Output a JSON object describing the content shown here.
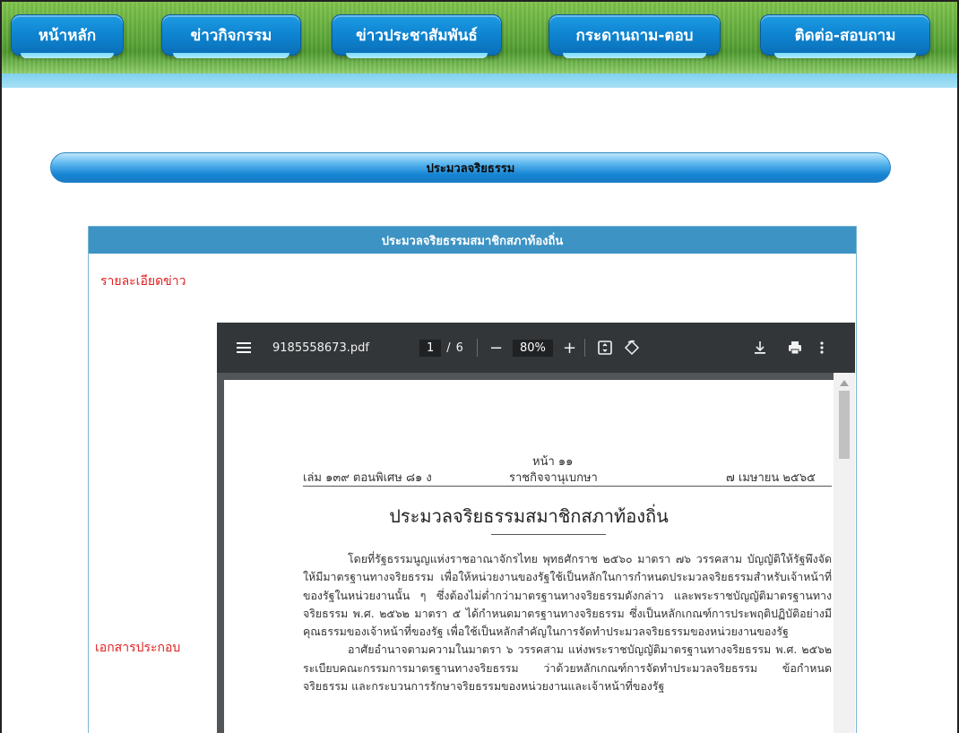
{
  "nav": {
    "items": [
      {
        "label": "หน้าหลัก"
      },
      {
        "label": "ข่าวกิจกรรม"
      },
      {
        "label": "ข่าวประชาสัมพันธ์"
      },
      {
        "label": "กระดานถาม-ตอบ"
      },
      {
        "label": "ติดต่อ-สอบถาม"
      }
    ]
  },
  "section": {
    "title": "ประมวลจริยธรรม"
  },
  "card": {
    "title": "ประมวลจริยธรรมสมาชิกสภาท้องถิ่น",
    "details_label": "รายละเอียดข่าว",
    "attachment_label": "เอกสารประกอบ"
  },
  "pdf_viewer": {
    "filename": "9185558673.pdf",
    "current_page": "1",
    "page_separator": "/",
    "total_pages": "6",
    "zoom": "80%",
    "icons": {
      "menu": "hamburger-icon",
      "zoom_out": "minus-icon",
      "zoom_in": "plus-icon",
      "fit": "fit-page-icon",
      "rotate": "rotate-icon",
      "download": "download-icon",
      "print": "print-icon",
      "more": "more-vert-icon"
    },
    "document": {
      "page_no": "หน้า ๑๑",
      "header_left": "เล่ม ๑๓๙ ตอนพิเศษ ๘๑ ง",
      "header_center": "ราชกิจจานุเบกษา",
      "header_right": "๗ เมษายน ๒๕๖๕",
      "title": "ประมวลจริยธรรมสมาชิกสภาท้องถิ่น",
      "paragraph_1": "โดยที่รัฐธรรมนูญแห่งราชอาณาจักรไทย พุทธศักราช ๒๕๖๐ มาตรา ๗๖ วรรคสาม บัญญัติให้รัฐพึงจัดให้มีมาตรฐานทางจริยธรรม เพื่อให้หน่วยงานของรัฐใช้เป็นหลักในการกำหนดประมวลจริยธรรมสำหรับเจ้าหน้าที่ของรัฐในหน่วยงานนั้น ๆ ซึ่งต้องไม่ต่ำกว่ามาตรฐานทางจริยธรรมดังกล่าว และพระราชบัญญัติมาตรฐานทางจริยธรรม พ.ศ. ๒๕๖๒ มาตรา ๕ ได้กำหนดมาตรฐานทางจริยธรรม ซึ่งเป็นหลักเกณฑ์การประพฤติปฏิบัติอย่างมีคุณธรรมของเจ้าหน้าที่ของรัฐ เพื่อใช้เป็นหลักสำคัญในการจัดทำประมวลจริยธรรมของหน่วยงานของรัฐ",
      "paragraph_2": "อาศัยอำนาจตามความในมาตรา ๖ วรรคสาม แห่งพระราชบัญญัติมาตรฐานทางจริยธรรม พ.ศ. ๒๕๖๒ ระเบียบคณะกรรมการมาตรฐานทางจริยธรรม ว่าด้วยหลักเกณฑ์การจัดทำประมวลจริยธรรม ข้อกำหนดจริยธรรม และกระบวนการรักษาจริยธรรมของหน่วยงานและเจ้าหน้าที่ของรัฐ"
    }
  }
}
